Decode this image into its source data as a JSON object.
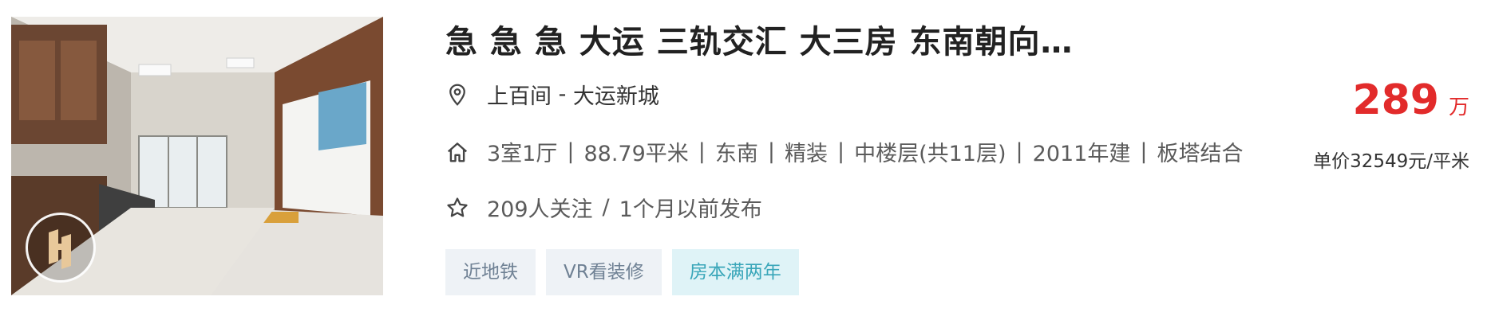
{
  "listing": {
    "title": "急 急 急 大运 三轨交汇 大三房 东南朝向…",
    "location": {
      "community": "上百间",
      "separator": " - ",
      "area": "大运新城"
    },
    "meta": [
      "3室1厅",
      "88.79平米",
      "东南",
      "精装",
      "中楼层(共11层)",
      "2011年建",
      "板塔结合"
    ],
    "meta_separator": "|",
    "followers": "209人关注",
    "follow_separator": "/",
    "published": "1个月以前发布",
    "tags": [
      {
        "label": "近地铁",
        "style": "gray"
      },
      {
        "label": "VR看装修",
        "style": "gray"
      },
      {
        "label": "房本满两年",
        "style": "teal"
      }
    ],
    "price": {
      "total": "289",
      "unit": "万",
      "unit_price": "单价32549元/平米"
    }
  },
  "icons": {
    "location": "location-pin-icon",
    "house": "house-icon",
    "follow": "star-icon",
    "vr": "vr-badge-icon"
  },
  "colors": {
    "price": "#e22b2b",
    "tag_gray_bg": "#eef2f6",
    "tag_gray_text": "#6f8194",
    "tag_teal_bg": "#dff3f7",
    "tag_teal_text": "#39a6b9"
  }
}
